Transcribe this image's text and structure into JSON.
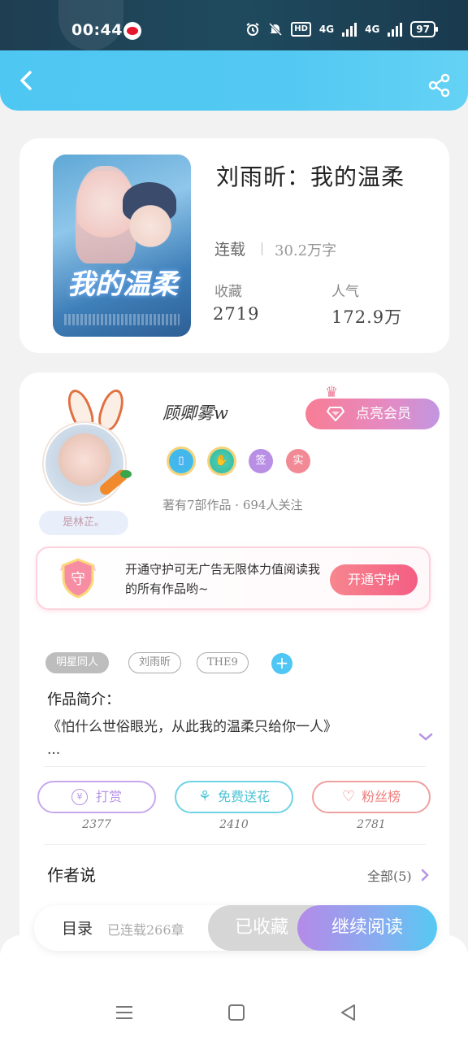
{
  "status_bar": {
    "time": "00:44",
    "hd": "HD",
    "net1": "4G",
    "net2": "4G",
    "battery": "97"
  },
  "book": {
    "title": "刘雨昕：我的温柔",
    "status": "连载",
    "words": "30.2万字",
    "collect_label": "收藏",
    "collect_value": "2719",
    "popularity_label": "人气",
    "popularity_value": "172.9万",
    "cover_title": "我的温柔"
  },
  "author": {
    "name": "顾卿雾w",
    "vip_button": "点亮会员",
    "badges": [
      "",
      "",
      "签",
      "实"
    ],
    "stats": "著有7部作品 · 694人关注",
    "name_tag": "是林芷。"
  },
  "guard": {
    "shield_char": "守",
    "text": "开通守护可无广告无限体力值阅读我的所有作品哟~",
    "button": "开通守护"
  },
  "tags": [
    "明星同人",
    "刘雨昕",
    "THE9"
  ],
  "tag_add": "+",
  "intro": {
    "heading": "作品简介：",
    "text": "《怕什么世俗眼光，从此我的温柔只给你一人》",
    "ellipsis": "..."
  },
  "actions": [
    {
      "label": "打赏",
      "count": "2377",
      "color": "#b794e6",
      "icon": "yen-icon"
    },
    {
      "label": "免费送花",
      "count": "2410",
      "color": "#5ccfe0",
      "icon": "flower-icon"
    },
    {
      "label": "粉丝榜",
      "count": "2781",
      "color": "#ef7d7d",
      "icon": "user-heart-icon"
    }
  ],
  "author_says": {
    "heading": "作者说",
    "all_link": "全部(5)"
  },
  "read_bar": {
    "menu": "目录",
    "chapters": "已连载266章",
    "collected": "已收藏",
    "continue": "继续阅读"
  },
  "colors": {
    "header": "#52c8f2",
    "accent_pink": "#f45d83",
    "accent_purple": "#b794e6"
  }
}
